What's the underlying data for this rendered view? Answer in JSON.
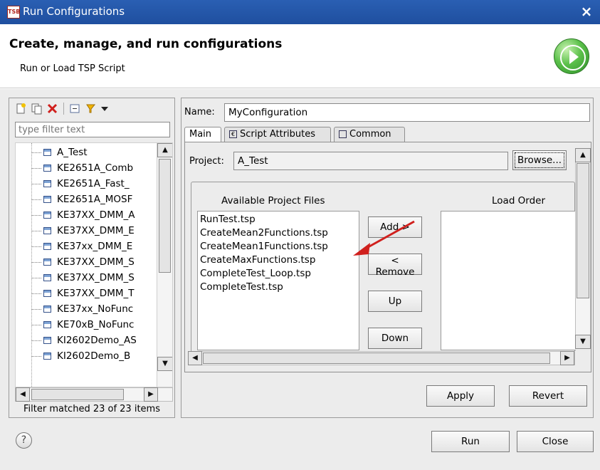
{
  "window": {
    "title": "Run Configurations",
    "app_icon_text": "TSB",
    "close_glyph": "×"
  },
  "header": {
    "title": "Create, manage, and run configurations",
    "subtitle": "Run or Load TSP Script",
    "badge_icon": "run-icon"
  },
  "left": {
    "toolbar_icons": [
      "new-configuration-icon",
      "duplicate-icon",
      "delete-icon",
      "collapse-all-icon",
      "filter-icon",
      "view-menu-icon"
    ],
    "filter_placeholder": "type filter text",
    "tree_items": [
      "A_Test",
      "KE2651A_Comb",
      "KE2651A_Fast_",
      "KE2651A_MOSF",
      "KE37XX_DMM_A",
      "KE37XX_DMM_E",
      "KE37xx_DMM_E",
      "KE37XX_DMM_S",
      "KE37XX_DMM_S",
      "KE37XX_DMM_T",
      "KE37xx_NoFunc",
      "KE70xB_NoFunc",
      "KI2602Demo_AS",
      "KI2602Demo_B"
    ],
    "status": "Filter matched 23 of 23 items"
  },
  "right": {
    "name_label": "Name:",
    "name_value": "MyConfiguration",
    "tabs": [
      "Main",
      "Script Attributes",
      "Common"
    ],
    "project_label": "Project:",
    "project_value": "A_Test",
    "browse_label": "Browse...",
    "available_label": "Available Project Files",
    "load_order_label": "Load Order",
    "available_files": [
      "RunTest.tsp",
      "CreateMean2Functions.tsp",
      "CreateMean1Functions.tsp",
      "CreateMaxFunctions.tsp",
      "CompleteTest_Loop.tsp",
      "CompleteTest.tsp"
    ],
    "buttons": {
      "add": "Add >",
      "remove": "< Remove",
      "up": "Up",
      "down": "Down"
    },
    "apply_label": "Apply",
    "revert_label": "Revert"
  },
  "footer": {
    "help_glyph": "?",
    "run_label": "Run",
    "close_label": "Close"
  },
  "colors": {
    "titlebar": "#1f4f9f",
    "arrow": "#d0201d",
    "run_badge": "#3ea33a"
  }
}
